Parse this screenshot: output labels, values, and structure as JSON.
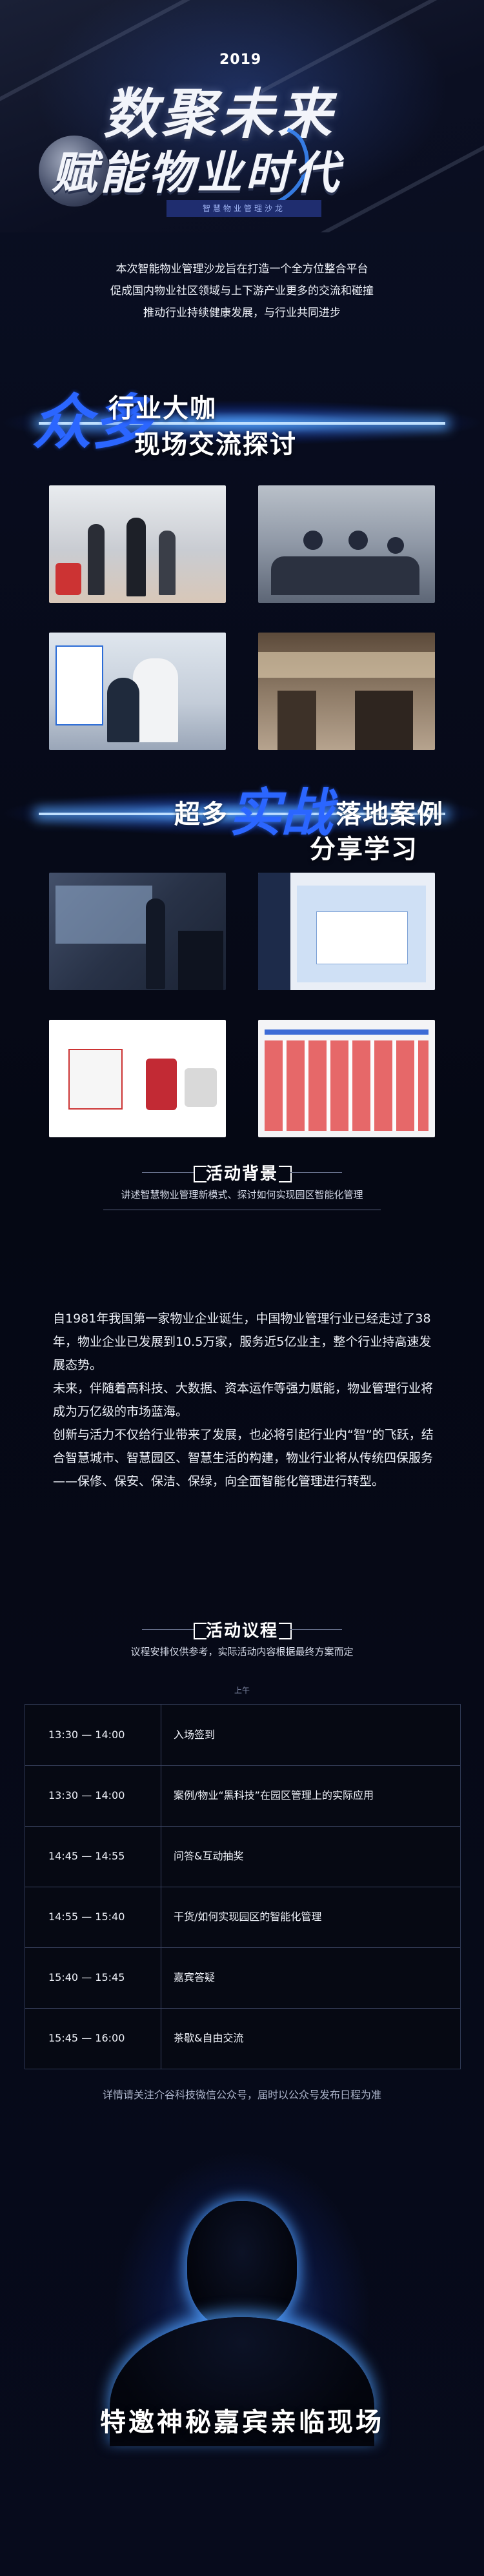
{
  "hero": {
    "year": "2019",
    "title_line1": "数聚未来",
    "title_line2": "赋能物业时代",
    "tagline": "智慧物业管理沙龙"
  },
  "intro": {
    "lines": [
      "本次智能物业管理沙龙旨在打造一个全方位整合平台",
      "促成国内物业社区领域与上下游产业更多的交流和碰撞",
      "推动行业持续健康发展，与行业共同进步"
    ]
  },
  "banner1": {
    "calligraphy": "众多",
    "line1": "行业大咖",
    "line2": "现场交流探讨"
  },
  "banner2": {
    "line1": "超多",
    "calligraphy": "实战",
    "line2": "落地案例",
    "line3": "分享学习"
  },
  "background_section": {
    "title": "活动背景",
    "subtitle": "讲述智慧物业管理新模式、探讨如何实现园区智能化管理",
    "paragraphs": [
      "自1981年我国第一家物业企业诞生，中国物业管理行业已经走过了38年，物业企业已发展到10.5万家，服务近5亿业主，整个行业持高速发展态势。",
      "未来，伴随着高科技、大数据、资本运作等强力赋能，物业管理行业将成为万亿级的市场蓝海。",
      "创新与活力不仅给行业带来了发展，也必将引起行业内“智”的飞跃，结合智慧城市、智慧园区、智慧生活的构建，物业行业将从传统四保服务——保修、保安、保洁、保绿，向全面智能化管理进行转型。"
    ]
  },
  "agenda_section": {
    "title": "活动议程",
    "subtitle": "议程安排仅供参考，实际活动内容根据最终方案而定",
    "day_label": "上午",
    "rows": [
      {
        "time": "13:30 — 14:00",
        "topic": "入场签到"
      },
      {
        "time": "13:30 — 14:00",
        "topic": "案例/物业“黑科技”在园区管理上的实际应用"
      },
      {
        "time": "14:45 — 14:55",
        "topic": "问答&互动抽奖"
      },
      {
        "time": "14:55 — 15:40",
        "topic": "干货/如何实现园区的智能化管理"
      },
      {
        "time": "15:40 — 15:45",
        "topic": "嘉宾答疑"
      },
      {
        "time": "15:45 — 16:00",
        "topic": "茶歇&自由交流"
      }
    ],
    "footer_note": "详情请关注介谷科技微信公众号，届时以公众号发布日程为准"
  },
  "guest": {
    "title": "特邀神秘嘉宾亲临现场"
  },
  "colors": {
    "accent_blue": "#2b66ff",
    "background": "#070b1c",
    "text": "#eef1f8"
  }
}
